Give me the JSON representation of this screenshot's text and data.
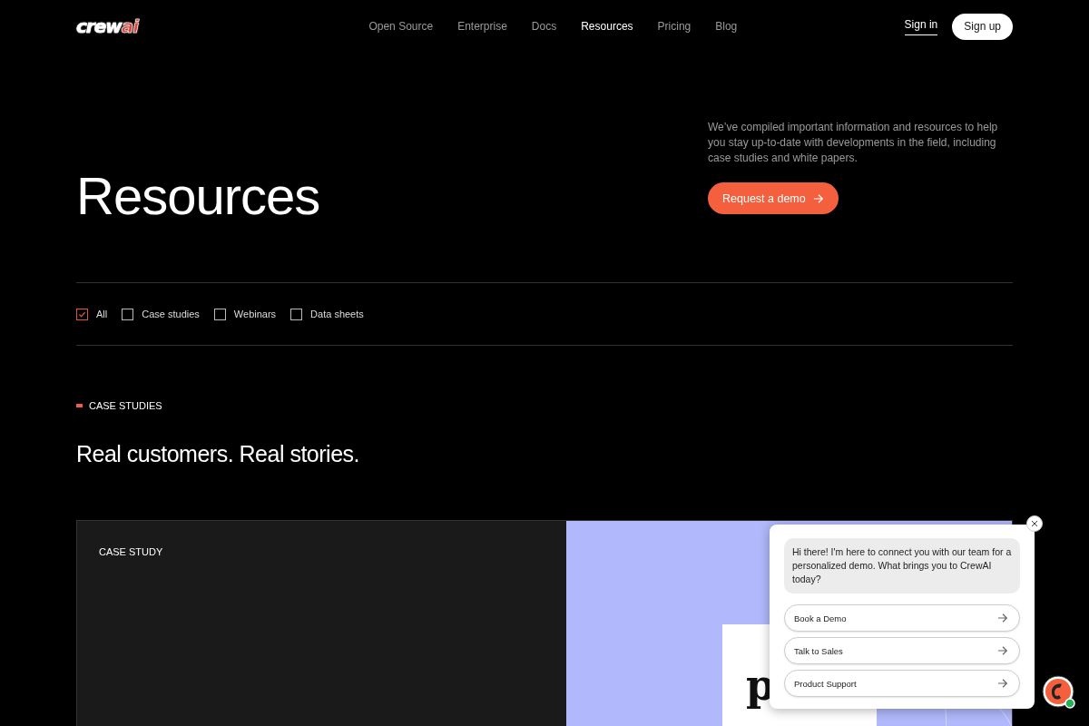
{
  "logo": {
    "text": "crew",
    "accent": "ai"
  },
  "nav": [
    {
      "label": "Open Source",
      "selected": false
    },
    {
      "label": "Enterprise",
      "selected": false
    },
    {
      "label": "Docs",
      "selected": false
    },
    {
      "label": "Resources",
      "selected": true
    },
    {
      "label": "Pricing",
      "selected": false
    },
    {
      "label": "Blog",
      "selected": false
    }
  ],
  "auth": {
    "sign_in": "Sign in",
    "sign_up": "Sign up"
  },
  "hero": {
    "title": "Resources",
    "description": "We’ve compiled important information and resources to help you stay up-to-date with developments in the field, including case studies and white papers.",
    "cta": "Request a demo"
  },
  "filters": [
    {
      "label": "All",
      "checked": true
    },
    {
      "label": "Case studies",
      "checked": false
    },
    {
      "label": "Webinars",
      "checked": false
    },
    {
      "label": "Data sheets",
      "checked": false
    }
  ],
  "section": {
    "eyebrow": "CASE STUDIES",
    "heading": "Real customers. Real stories."
  },
  "card": {
    "label": "CASE STUDY",
    "image_text": "p"
  },
  "chat": {
    "message": "Hi there! I'm here to connect you with our team for a personalized demo. What brings you to CrewAI today?",
    "options": [
      "Book a Demo",
      "Talk to Sales",
      "Product Support"
    ]
  }
}
